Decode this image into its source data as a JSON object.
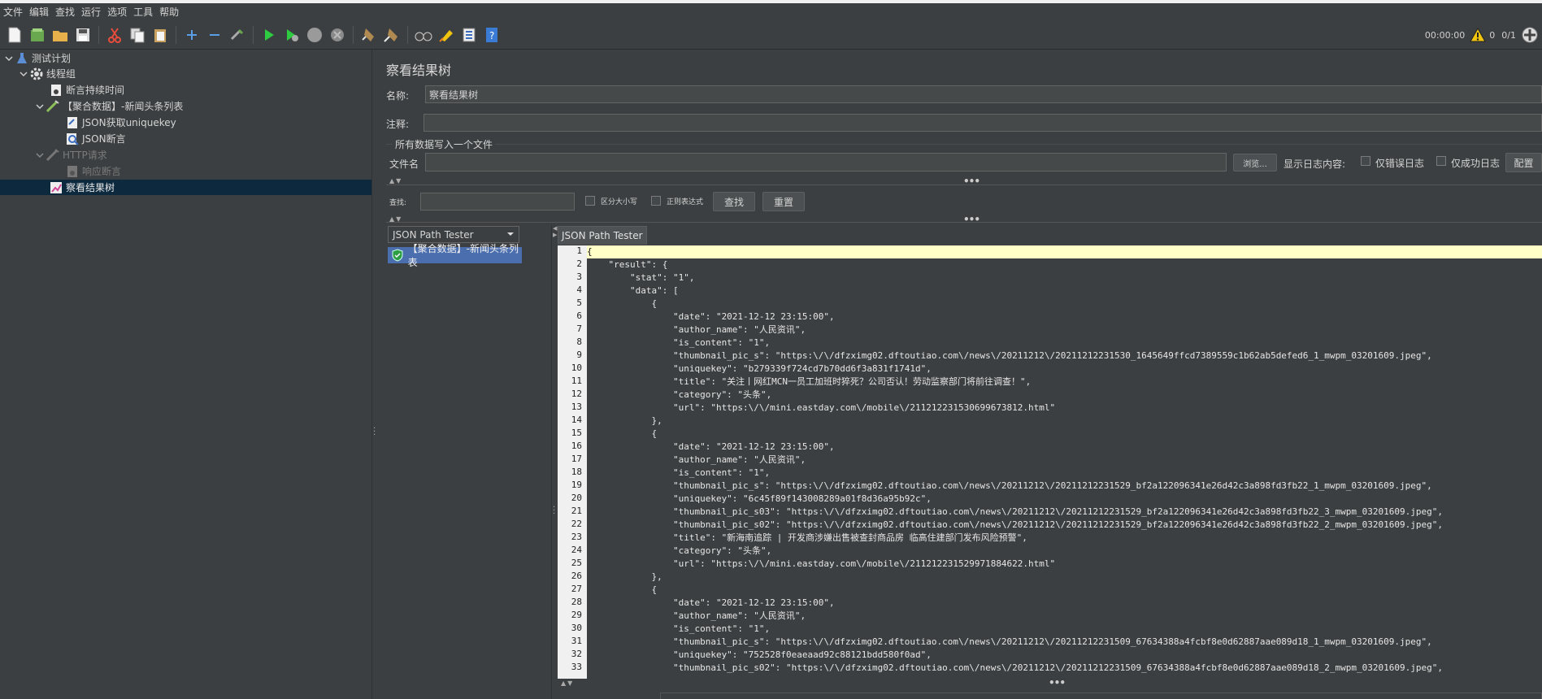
{
  "menu": [
    "文件",
    "编辑",
    "查找",
    "运行",
    "选项",
    "工具",
    "帮助"
  ],
  "status": {
    "timer": "00:00:00",
    "warnings": "0",
    "threads": "0/1"
  },
  "tree": [
    {
      "label": "测试计划",
      "level": 0,
      "icon": "flask-icon",
      "expanded": true,
      "state": "normal"
    },
    {
      "label": "线程组",
      "level": 1,
      "icon": "gear-icon",
      "expanded": true,
      "state": "normal"
    },
    {
      "label": "断言持续时间",
      "level": 2,
      "icon": "assertion-icon",
      "expanded": null,
      "state": "normal"
    },
    {
      "label": "【聚合数据】-新闻头条列表",
      "level": 2,
      "icon": "sampler-pen-icon",
      "expanded": true,
      "state": "normal"
    },
    {
      "label": "JSON获取uniquekey",
      "level": 3,
      "icon": "extractor-icon",
      "expanded": null,
      "state": "normal"
    },
    {
      "label": "JSON断言",
      "level": 3,
      "icon": "json-assertion-icon",
      "expanded": null,
      "state": "normal"
    },
    {
      "label": "HTTP请求",
      "level": 2,
      "icon": "sampler-pen-icon",
      "expanded": true,
      "state": "disabled"
    },
    {
      "label": "响应断言",
      "level": 3,
      "icon": "response-assertion-icon",
      "expanded": null,
      "state": "disabled"
    },
    {
      "label": "察看结果树",
      "level": 2,
      "icon": "result-tree-icon",
      "expanded": null,
      "state": "selected"
    }
  ],
  "panel": {
    "title": "察看结果树",
    "name_label": "名称:",
    "name_value": "察看结果树",
    "comment_label": "注释:",
    "comment_value": "",
    "file_section": "所有数据写入一个文件",
    "filename_label": "文件名",
    "filename_value": "",
    "browse": "浏览...",
    "log_label": "显示日志内容:",
    "errors_only": "仅错误日志",
    "success_only": "仅成功日志",
    "configure": "配置"
  },
  "search": {
    "label": "查找:",
    "value": "",
    "case_sensitive": "区分大小写",
    "regex": "正则表达式",
    "find": "查找",
    "reset": "重置"
  },
  "results": {
    "renderer": "JSON Path Tester",
    "items": [
      "【聚合数据】-新闻头条列表"
    ],
    "tab": "JSON Path Tester"
  },
  "json_lines": [
    "{",
    "    \"result\": {",
    "        \"stat\": \"1\",",
    "        \"data\": [",
    "            {",
    "                \"date\": \"2021-12-12 23:15:00\",",
    "                \"author_name\": \"人民资讯\",",
    "                \"is_content\": \"1\",",
    "                \"thumbnail_pic_s\": \"https:\\/\\/dfzximg02.dftoutiao.com\\/news\\/20211212\\/20211212231530_1645649ffcd7389559c1b62ab5defed6_1_mwpm_03201609.jpeg\",",
    "                \"uniquekey\": \"b279339f724cd7b70dd6f3a831f1741d\",",
    "                \"title\": \"关注丨网红MCN一员工加班时猝死？公司否认！劳动监察部门将前往调查！\",",
    "                \"category\": \"头条\",",
    "                \"url\": \"https:\\/\\/mini.eastday.com\\/mobile\\/211212231530699673812.html\"",
    "            },",
    "            {",
    "                \"date\": \"2021-12-12 23:15:00\",",
    "                \"author_name\": \"人民资讯\",",
    "                \"is_content\": \"1\",",
    "                \"thumbnail_pic_s\": \"https:\\/\\/dfzximg02.dftoutiao.com\\/news\\/20211212\\/20211212231529_bf2a122096341e26d42c3a898fd3fb22_1_mwpm_03201609.jpeg\",",
    "                \"uniquekey\": \"6c45f89f143008289a01f8d36a95b92c\",",
    "                \"thumbnail_pic_s03\": \"https:\\/\\/dfzximg02.dftoutiao.com\\/news\\/20211212\\/20211212231529_bf2a122096341e26d42c3a898fd3fb22_3_mwpm_03201609.jpeg\",",
    "                \"thumbnail_pic_s02\": \"https:\\/\\/dfzximg02.dftoutiao.com\\/news\\/20211212\\/20211212231529_bf2a122096341e26d42c3a898fd3fb22_2_mwpm_03201609.jpeg\",",
    "                \"title\": \"新海南追踪 | 开发商涉嫌出售被查封商品房 临高住建部门发布风险预警\",",
    "                \"category\": \"头条\",",
    "                \"url\": \"https:\\/\\/mini.eastday.com\\/mobile\\/211212231529971884622.html\"",
    "            },",
    "            {",
    "                \"date\": \"2021-12-12 23:15:00\",",
    "                \"author_name\": \"人民资讯\",",
    "                \"is_content\": \"1\",",
    "                \"thumbnail_pic_s\": \"https:\\/\\/dfzximg02.dftoutiao.com\\/news\\/20211212\\/20211212231509_67634388a4fcbf8e0d62887aae089d18_1_mwpm_03201609.jpeg\",",
    "                \"uniquekey\": \"752528f0eaeaad92c88121bdd580f0ad\",",
    "                \"thumbnail_pic_s02\": \"https:\\/\\/dfzximg02.dftoutiao.com\\/news\\/20211212\\/20211212231509_67634388a4fcbf8e0d62887aae089d18_2_mwpm_03201609.jpeg\","
  ]
}
